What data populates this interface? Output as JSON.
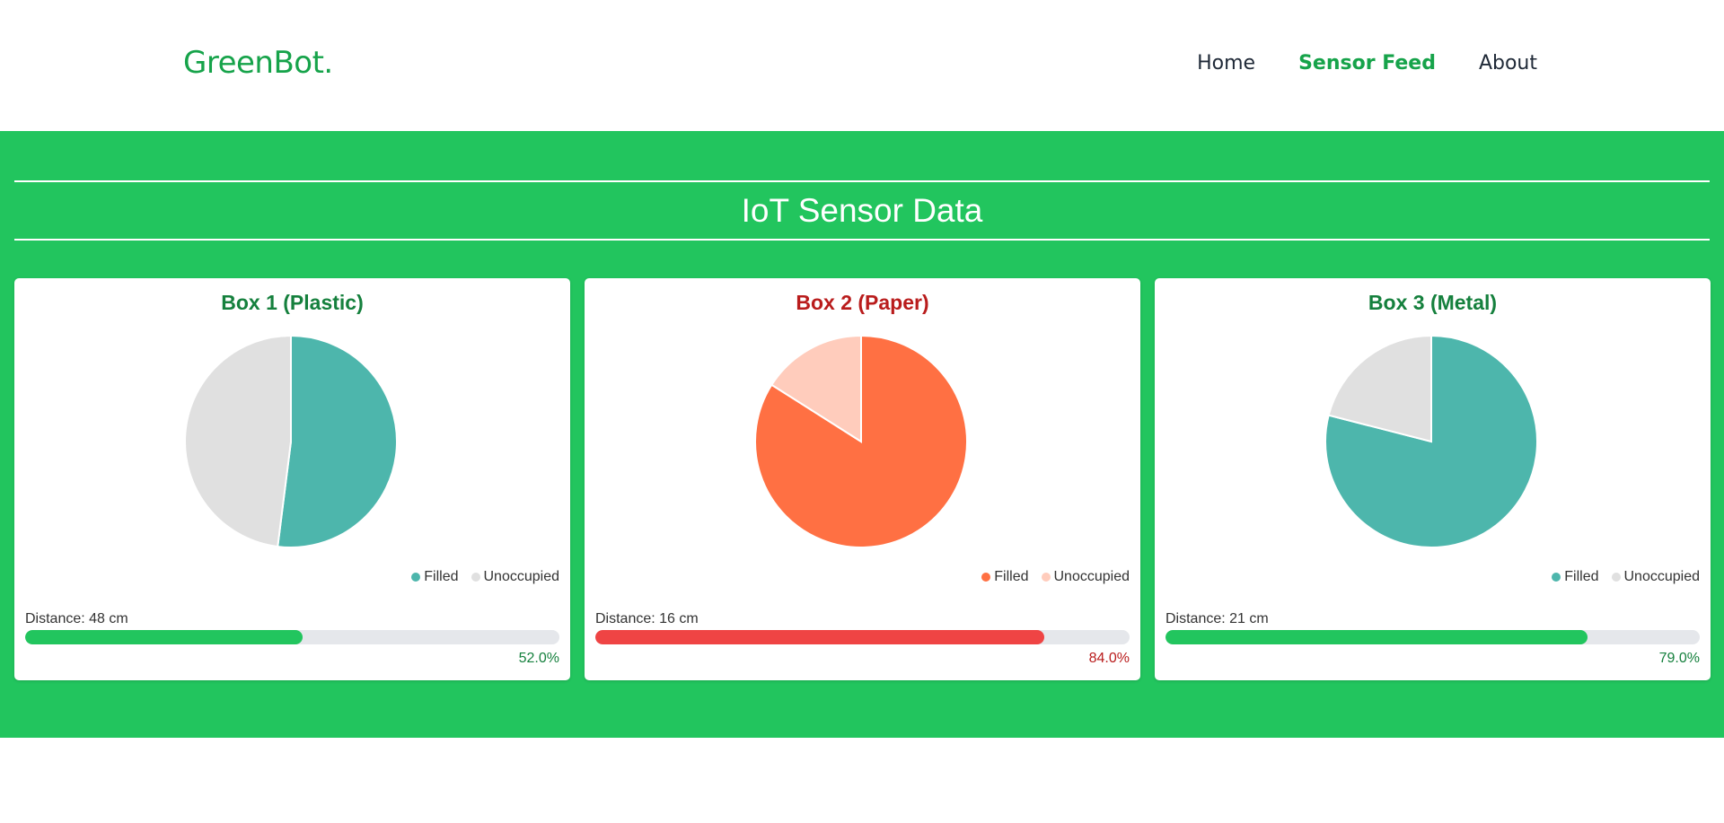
{
  "navbar": {
    "brand": "GreenBot.",
    "links": [
      {
        "label": "Home",
        "active": false
      },
      {
        "label": "Sensor Feed",
        "active": true
      },
      {
        "label": "About",
        "active": false
      }
    ]
  },
  "section": {
    "title": "IoT Sensor Data"
  },
  "cards": [
    {
      "title": "Box 1 (Plastic)",
      "title_status": "ok",
      "legend": [
        "Filled",
        "Unoccupied"
      ],
      "filled_color": "#4db6ac",
      "unoccupied_color": "#e0e0e0",
      "distance_label": "Distance: 48 cm",
      "bar_color": "#22c55e",
      "percent_label": "52.0%"
    },
    {
      "title": "Box 2 (Paper)",
      "title_status": "warn",
      "legend": [
        "Filled",
        "Unoccupied"
      ],
      "filled_color": "#ff7043",
      "unoccupied_color": "#ffccbc",
      "distance_label": "Distance: 16 cm",
      "bar_color": "#ef4444",
      "percent_label": "84.0%"
    },
    {
      "title": "Box 3 (Metal)",
      "title_status": "ok",
      "legend": [
        "Filled",
        "Unoccupied"
      ],
      "filled_color": "#4db6ac",
      "unoccupied_color": "#e0e0e0",
      "distance_label": "Distance: 21 cm",
      "bar_color": "#22c55e",
      "percent_label": "79.0%"
    }
  ],
  "chart_data": [
    {
      "type": "pie",
      "categories": [
        "Filled",
        "Unoccupied"
      ],
      "values": [
        52,
        48
      ]
    },
    {
      "type": "pie",
      "categories": [
        "Filled",
        "Unoccupied"
      ],
      "values": [
        84,
        16
      ]
    },
    {
      "type": "pie",
      "categories": [
        "Filled",
        "Unoccupied"
      ],
      "values": [
        79,
        21
      ]
    }
  ]
}
